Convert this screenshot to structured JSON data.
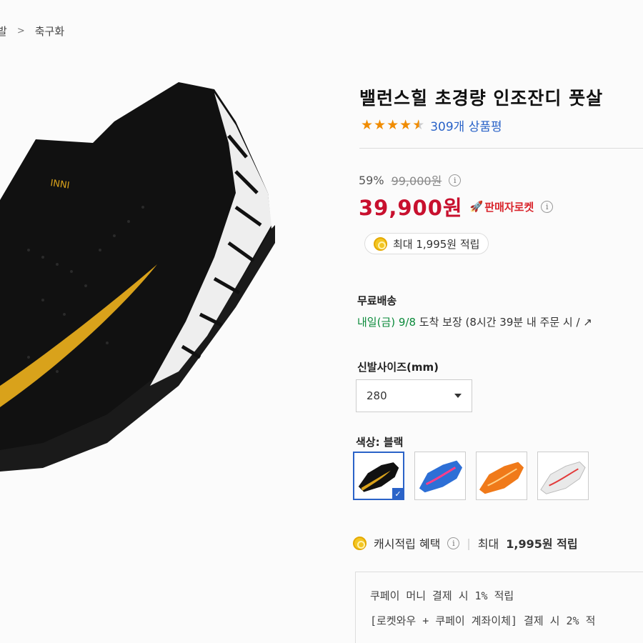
{
  "breadcrumb": {
    "parent": "발",
    "separator": ">",
    "current": "축구화"
  },
  "product": {
    "title": "밸런스힐 초경량 인조잔디 풋살",
    "rating": 4.5,
    "review_count": "309개 상품평"
  },
  "pricing": {
    "discount": "59%",
    "original_price": "99,000원",
    "sale_price": "39,900원",
    "rocket_badge": "판매자로켓",
    "reward_text": "최대 1,995원 적립"
  },
  "shipping": {
    "title": "무료배송",
    "date_prefix": "내일(금) 9/8",
    "date_suffix": "도착 보장 (8시간 39분  내 주문 시 / ↗"
  },
  "options": {
    "size_label": "신발사이즈(mm)",
    "size_selected": "280",
    "color_label": "색상: 블랙",
    "swatches": [
      {
        "name": "black",
        "color": "#111111",
        "accent": "#d9a21b",
        "selected": true
      },
      {
        "name": "blue",
        "color": "#2d6fd6",
        "accent": "#ff3d8a",
        "selected": false
      },
      {
        "name": "orange",
        "color": "#f07a1a",
        "accent": "#ffd28a",
        "selected": false
      },
      {
        "name": "white",
        "color": "#e9e9e9",
        "accent": "#e23a3a",
        "selected": false
      }
    ]
  },
  "cash": {
    "label": "캐시적립 혜택",
    "max_prefix": "최대",
    "max_amount": "1,995원 적립",
    "lines": [
      "쿠페이 머니 결제 시 1% 적립",
      "[로켓와우 + 쿠페이 계좌이체] 결제 시 2% 적"
    ]
  },
  "colors": {
    "price_red": "#c8102e",
    "link_blue": "#2a63c8",
    "star_orange": "#f08c00",
    "green": "#0a8a3a"
  }
}
